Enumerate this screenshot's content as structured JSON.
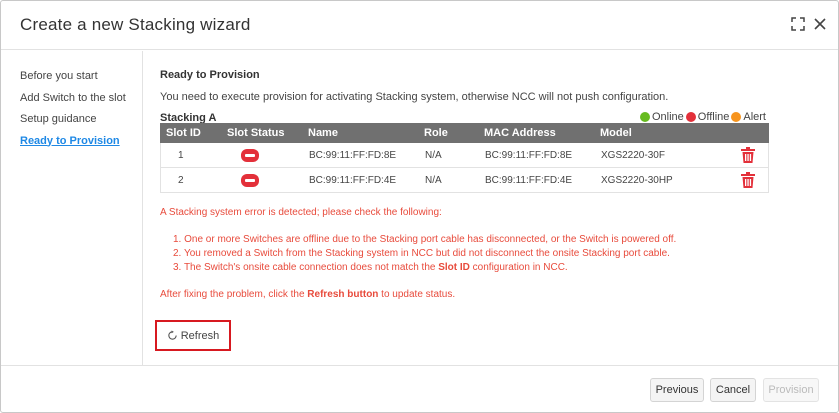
{
  "dialog": {
    "title": "Create a new Stacking wizard"
  },
  "nav": {
    "items": [
      {
        "label": "Before you start"
      },
      {
        "label": "Add Switch to the slot"
      },
      {
        "label": "Setup guidance"
      },
      {
        "label": "Ready to Provision"
      }
    ],
    "active_index": 3
  },
  "main": {
    "section_title": "Ready to Provision",
    "info_text": "You need to execute provision for activating Stacking system, otherwise NCC will not push configuration.",
    "stack_name": "Stacking A",
    "legend": [
      {
        "label": "Online",
        "color": "#66bb1f"
      },
      {
        "label": "Offline",
        "color": "#e3303a"
      },
      {
        "label": "Alert",
        "color": "#f7941d"
      }
    ],
    "table": {
      "headers": [
        "Slot ID",
        "Slot Status",
        "Name",
        "Role",
        "MAC Address",
        "Model"
      ],
      "rows": [
        {
          "slot": "1",
          "status": "offline",
          "name": "BC:99:11:FF:FD:8E",
          "role": "N/A",
          "mac": "BC:99:11:FF:FD:8E",
          "model": "XGS2220-30F"
        },
        {
          "slot": "2",
          "status": "offline",
          "name": "BC:99:11:FF:FD:4E",
          "role": "N/A",
          "mac": "BC:99:11:FF:FD:4E",
          "model": "XGS2220-30HP"
        }
      ]
    },
    "error": {
      "heading": "A Stacking system error is detected; please check the following:",
      "items": [
        {
          "prefix": "1. One or more Switches are offline due to the Stacking port cable has disconnected, or the Switch is powered off.",
          "bold": "",
          "suffix": ""
        },
        {
          "prefix": "2. You removed a Switch from the Stacking system in NCC but did not disconnect the onsite Stacking port cable.",
          "bold": "",
          "suffix": ""
        },
        {
          "prefix": "3. The Switch's onsite cable connection does not match the ",
          "bold": "Slot ID",
          "suffix": " configuration in NCC."
        }
      ],
      "after_prefix": "After fixing the problem, click the ",
      "after_bold": "Refresh button",
      "after_suffix": " to update status."
    },
    "refresh_label": "Refresh"
  },
  "footer": {
    "previous_label": "Previous",
    "cancel_label": "Cancel",
    "provision_label": "Provision"
  },
  "icons": {
    "expand": "expand-icon",
    "close": "close-icon",
    "trash": "trash-icon",
    "refresh": "refresh-icon",
    "status": "offline-status-icon"
  },
  "colors": {
    "accent_link": "#1e88e5",
    "error_text": "#e84b3c",
    "table_header": "#707070",
    "highlight_border": "#d71920",
    "trash": "#e3303a"
  }
}
